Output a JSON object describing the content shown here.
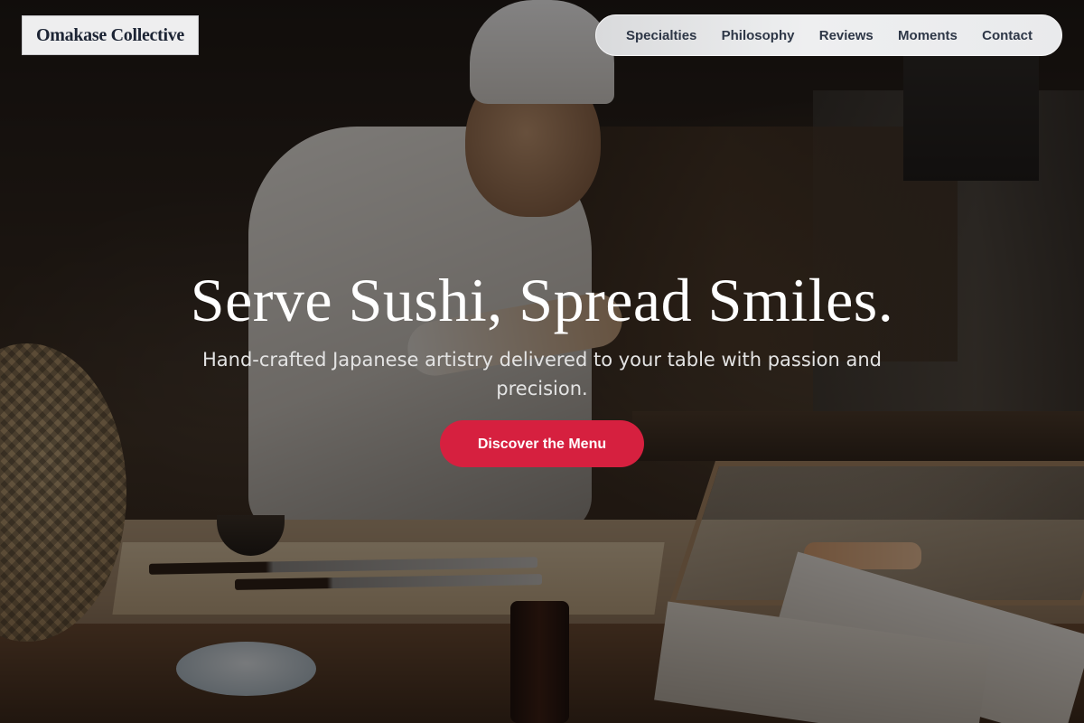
{
  "header": {
    "brand": "Omakase Collective",
    "nav": [
      {
        "label": "Specialties"
      },
      {
        "label": "Philosophy"
      },
      {
        "label": "Reviews"
      },
      {
        "label": "Moments"
      },
      {
        "label": "Contact"
      }
    ]
  },
  "hero": {
    "title": "Serve Sushi, Spread Smiles.",
    "subtitle": "Hand-crafted Japanese artistry delivered to your table with passion and precision.",
    "cta_label": "Discover the Menu"
  },
  "colors": {
    "accent": "#d6203f",
    "nav_text": "#2e3747",
    "brand_text": "#1c2434",
    "overlay": "rgba(8,6,5,0.5)"
  }
}
